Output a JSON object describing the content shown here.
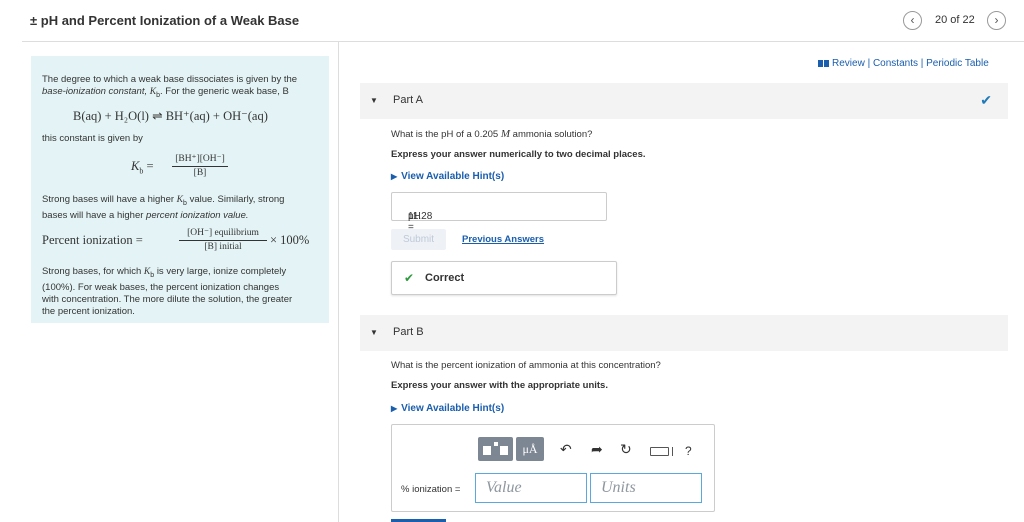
{
  "header": {
    "title": "± pH and Percent Ionization of a Weak Base",
    "prev_icon": "chevron-left-icon",
    "next_icon": "chevron-right-icon",
    "counter": "20 of 22"
  },
  "info": {
    "p1_a": "The degree to which a weak base dissociates is given by the",
    "p1_b_italic": "base-ionization constant,",
    "p1_b_rest": "For the generic weak base, B",
    "kb_symbol": "Kb",
    "reaction": "B(aq) + H₂O(l) ⇌ BH⁺(aq) + OH⁻(aq)",
    "p2": "this constant is given by",
    "kb_lhs": "Kb =",
    "kb_num": "[BH⁺][OH⁻]",
    "kb_den": "[B]",
    "p3_a": "Strong bases will have a higher",
    "p3_a_rest": "value. Similarly, strong",
    "p3_b": "bases will have a higher",
    "p3_b_italic": "percent ionization value.",
    "pi_lhs": "Percent ionization =",
    "pi_num": "[OH⁻] equilibrium",
    "pi_den": "[B] initial",
    "pi_rhs": "× 100%",
    "p4_a": "Strong bases, for which",
    "p4_a_rest": "is very large, ionize completely",
    "p4_b": "(100%). For weak bases, the percent ionization changes",
    "p4_c": "with concentration. The more dilute the solution, the greater",
    "p4_d": "the percent ionization."
  },
  "links": {
    "icon": "book-icon",
    "text": "Review | Constants | Periodic Table"
  },
  "partA": {
    "label": "Part A",
    "question": "What is the pH of a 0.205 M ammonia solution?",
    "instruction": "Express your answer numerically to two decimal places.",
    "hint": "View Available Hint(s)",
    "answer_label": "pH =",
    "answer_value": "11.28",
    "submit": "Submit",
    "previous_answers": "Previous Answers",
    "status": "Correct"
  },
  "partB": {
    "label": "Part B",
    "question": "What is the percent ionization of ammonia at this concentration?",
    "instruction": "Express your answer with the appropriate units.",
    "hint": "View Available Hint(s)",
    "mu_label": "μÅ",
    "help": "?",
    "field_label": "% ionization =",
    "value_placeholder": "Value",
    "units_placeholder": "Units"
  }
}
